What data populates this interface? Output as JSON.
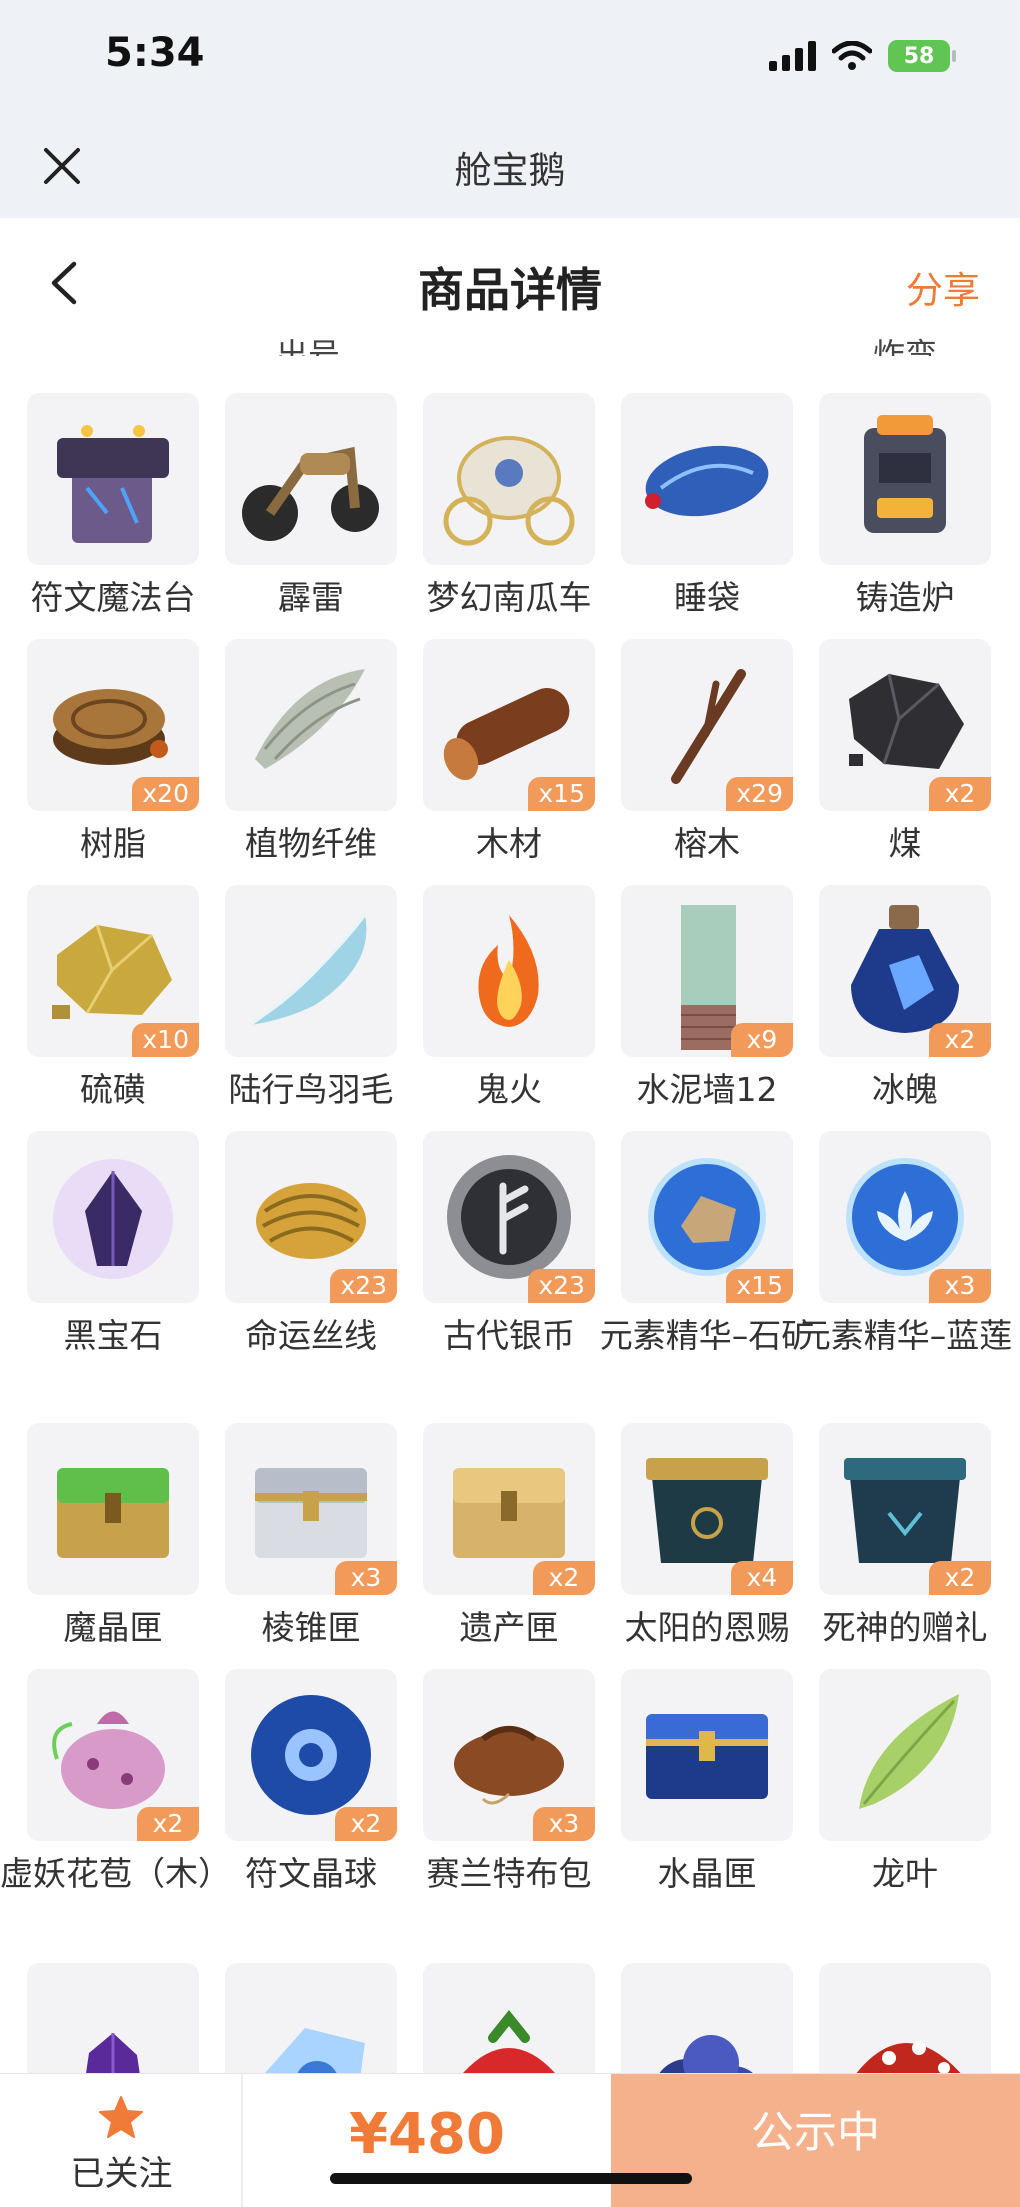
{
  "status_bar": {
    "time": "5:34",
    "battery": "58"
  },
  "app": {
    "title": "舱宝鹅"
  },
  "page": {
    "title": "商品详情",
    "share": "分享"
  },
  "cut_labels": [
    "出号",
    "炸弯"
  ],
  "rows": [
    [
      {
        "label": "符文魔法台",
        "qty": "",
        "icon": "rune-altar"
      },
      {
        "label": "霹雷",
        "qty": "",
        "icon": "motorcycle"
      },
      {
        "label": "梦幻南瓜车",
        "qty": "",
        "icon": "pumpkin-carriage"
      },
      {
        "label": "睡袋",
        "qty": "",
        "icon": "sleeping-bag"
      },
      {
        "label": "铸造炉",
        "qty": "",
        "icon": "forge-furnace"
      }
    ],
    [
      {
        "label": "树脂",
        "qty": "x20",
        "icon": "resin"
      },
      {
        "label": "植物纤维",
        "qty": "",
        "icon": "plant-fiber"
      },
      {
        "label": "木材",
        "qty": "x15",
        "icon": "log"
      },
      {
        "label": "榕木",
        "qty": "x29",
        "icon": "banyan-branch"
      },
      {
        "label": "煤",
        "qty": "x2",
        "icon": "coal"
      }
    ],
    [
      {
        "label": "硫磺",
        "qty": "x10",
        "icon": "sulfur"
      },
      {
        "label": "陆行鸟羽毛",
        "qty": "",
        "icon": "feather"
      },
      {
        "label": "鬼火",
        "qty": "",
        "icon": "ghost-fire"
      },
      {
        "label": "水泥墙12",
        "qty": "x9",
        "icon": "cement-wall"
      },
      {
        "label": "冰魄",
        "qty": "x2",
        "icon": "ice-potion"
      }
    ],
    [
      {
        "label": "黑宝石",
        "qty": "",
        "icon": "black-gem"
      },
      {
        "label": "命运丝线",
        "qty": "x23",
        "icon": "golden-thread"
      },
      {
        "label": "古代银币",
        "qty": "x23",
        "icon": "silver-coin"
      },
      {
        "label": "元素精华–石矿",
        "qty": "x15",
        "icon": "essence-orb-rock"
      },
      {
        "label": "元素精华–蓝莲",
        "qty": "x3",
        "icon": "essence-orb-lotus"
      }
    ],
    [
      {
        "label": "魔晶匣",
        "qty": "",
        "icon": "green-chest"
      },
      {
        "label": "棱锥匣",
        "qty": "x3",
        "icon": "silver-chest"
      },
      {
        "label": "遗产匣",
        "qty": "x2",
        "icon": "gold-chest"
      },
      {
        "label": "太阳的恩赐",
        "qty": "x4",
        "icon": "sun-box"
      },
      {
        "label": "死神的赠礼",
        "qty": "x2",
        "icon": "reaper-box"
      }
    ],
    [
      {
        "label": "虚妖花苞（木）",
        "qty": "x2",
        "icon": "flower-bud"
      },
      {
        "label": "符文晶球",
        "qty": "x2",
        "icon": "rune-orb"
      },
      {
        "label": "赛兰特布包",
        "qty": "x3",
        "icon": "cloth-bag"
      },
      {
        "label": "水晶匣",
        "qty": "",
        "icon": "crystal-chest"
      },
      {
        "label": "龙叶",
        "qty": "",
        "icon": "dragon-leaf"
      }
    ],
    [
      {
        "label": "",
        "qty": "",
        "icon": "purple-crystal"
      },
      {
        "label": "",
        "qty": "",
        "icon": "ice-rune"
      },
      {
        "label": "",
        "qty": "",
        "icon": "strawberry"
      },
      {
        "label": "",
        "qty": "",
        "icon": "blueberry"
      },
      {
        "label": "",
        "qty": "",
        "icon": "mushroom"
      }
    ]
  ],
  "bottom": {
    "follow_label": "已关注",
    "price": "¥480",
    "status": "公示中"
  },
  "colors": {
    "accent": "#f07b39",
    "status_button": "#f5b08c",
    "badge": "#f29a5a"
  }
}
